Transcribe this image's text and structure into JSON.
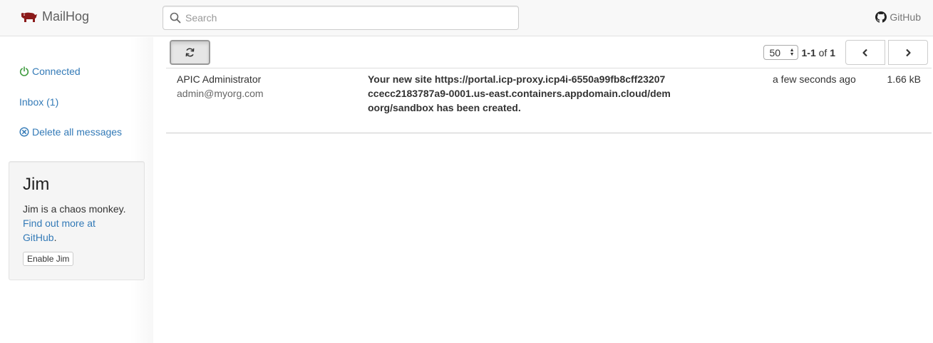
{
  "header": {
    "brand": "MailHog",
    "search_placeholder": "Search",
    "github_label": "GitHub"
  },
  "sidebar": {
    "connected_label": "Connected",
    "inbox_label": "Inbox (1)",
    "delete_all_label": "Delete all messages"
  },
  "jim": {
    "title": "Jim",
    "description": "Jim is a chaos monkey.",
    "link_text": "Find out more at GitHub",
    "period": ".",
    "enable_button": "Enable Jim"
  },
  "toolbar": {
    "per_page": "50",
    "range": "1-1",
    "of_label": "of",
    "total": "1"
  },
  "messages": [
    {
      "from_name": "APIC Administrator",
      "from_email": "admin@myorg.com",
      "subject": "Your new site https://portal.icp-proxy.icp4i-6550a99fb8cff23207ccecc2183787a9-0001.us-east.containers.appdomain.cloud/demoorg/sandbox has been created.",
      "time": "a few seconds ago",
      "size": "1.66 kB"
    }
  ],
  "colors": {
    "link": "#337ab7",
    "brand_logo": "#8b1a1a",
    "connected": "#3c9a3c"
  },
  "icons": {
    "brand": "pig-icon",
    "search": "search-icon",
    "github": "github-icon",
    "connected": "power-icon",
    "delete": "times-circle-icon",
    "refresh": "refresh-icon",
    "prev": "chevron-left-icon",
    "next": "chevron-right-icon"
  }
}
